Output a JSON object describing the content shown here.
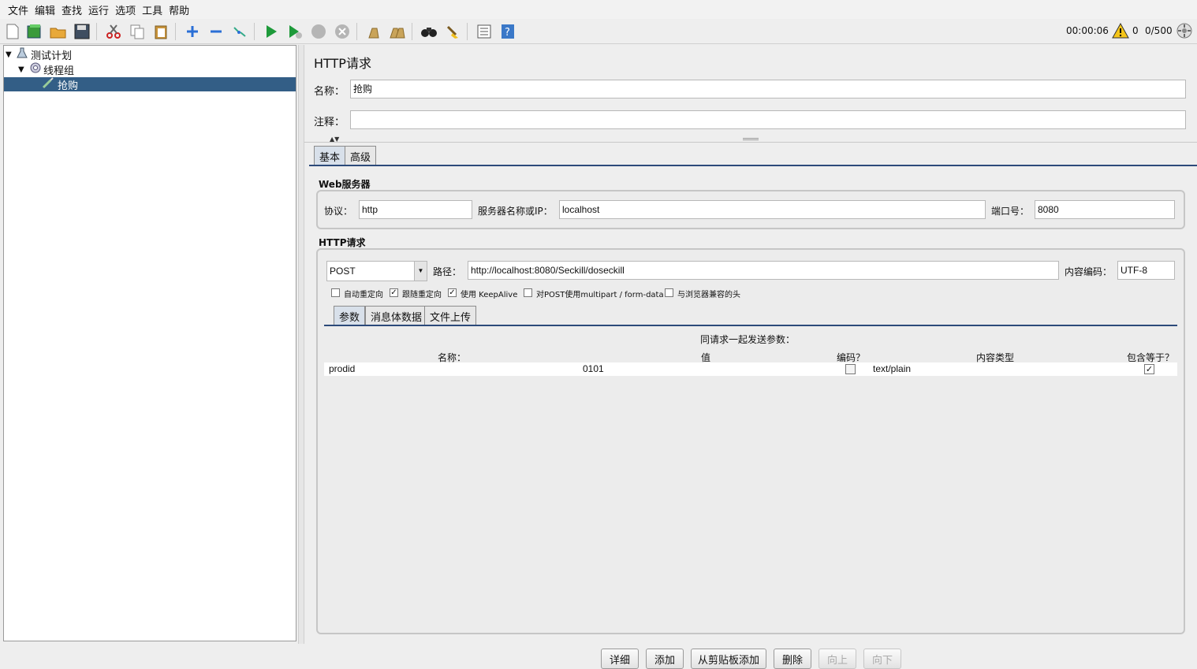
{
  "menu": [
    "文件",
    "编辑",
    "查找",
    "运行",
    "选项",
    "工具",
    "帮助"
  ],
  "status": {
    "elapsed": "00:00:06",
    "warnings": "0",
    "threads": "0/500"
  },
  "tree": {
    "plan": "测试计划",
    "group": "线程组",
    "sampler": "抢购"
  },
  "panel": {
    "title": "HTTP请求",
    "name_label": "名称：",
    "name_value": "抢购",
    "comment_label": "注释：",
    "comment_value": "",
    "tabs": [
      "基本",
      "高级"
    ],
    "web_server": {
      "title": "Web服务器",
      "protocol_label": "协议：",
      "protocol": "http",
      "server_label": "服务器名称或IP：",
      "server": "localhost",
      "port_label": "端口号：",
      "port": "8080"
    },
    "http_request": {
      "title": "HTTP请求",
      "method": "POST",
      "path_label": "路径：",
      "path": "http://localhost:8080/Seckill/doseckill",
      "encoding_label": "内容编码：",
      "encoding": "UTF-8",
      "options": [
        {
          "label": "自动重定向",
          "checked": false
        },
        {
          "label": "跟随重定向",
          "checked": true
        },
        {
          "label": "使用 KeepAlive",
          "checked": true
        },
        {
          "label": "对POST使用multipart / form-data",
          "checked": false
        },
        {
          "label": "与浏览器兼容的头",
          "checked": false
        }
      ]
    },
    "sub_tabs": [
      "参数",
      "消息体数据",
      "文件上传"
    ],
    "params": {
      "caption": "同请求一起发送参数：",
      "headers": [
        "名称：",
        "值",
        "编码？",
        "内容类型",
        "包含等于？"
      ],
      "rows": [
        {
          "name": "prodid",
          "value": "0101",
          "encode": false,
          "content_type": "text/plain",
          "include_equals": true
        }
      ]
    },
    "buttons": {
      "detail": "详细",
      "add": "添加",
      "add_clipboard": "从剪贴板添加",
      "delete": "删除",
      "up": "向上",
      "down": "向下"
    }
  }
}
